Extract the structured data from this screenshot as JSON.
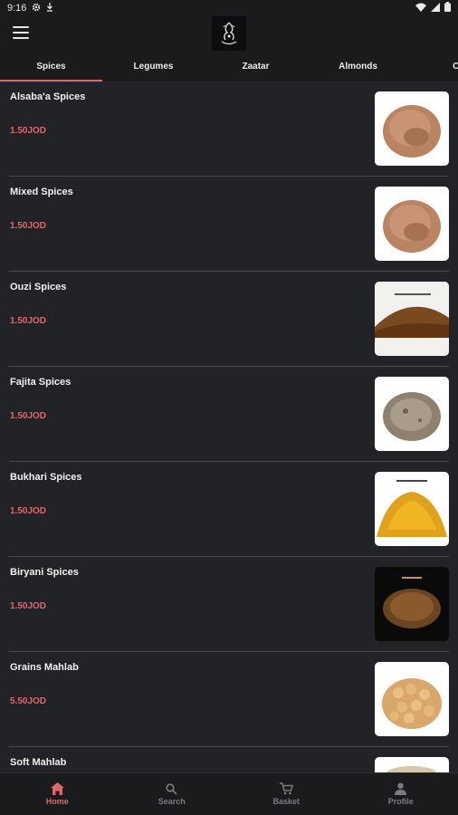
{
  "status": {
    "time": "9:16"
  },
  "tabs": [
    {
      "label": "Spices"
    },
    {
      "label": "Legumes"
    },
    {
      "label": "Zaatar"
    },
    {
      "label": "Almonds"
    },
    {
      "label": "Cof"
    }
  ],
  "items": [
    {
      "name": "Alsaba'a Spices",
      "price": "1.50JOD"
    },
    {
      "name": "Mixed Spices",
      "price": "1.50JOD"
    },
    {
      "name": "Ouzi Spices",
      "price": "1.50JOD"
    },
    {
      "name": "Fajita Spices",
      "price": "1.50JOD"
    },
    {
      "name": "Bukhari Spices",
      "price": "1.50JOD"
    },
    {
      "name": "Biryani Spices",
      "price": "1.50JOD"
    },
    {
      "name": "Grains Mahlab",
      "price": "5.50JOD"
    },
    {
      "name": "Soft Mahlab",
      "price": ""
    }
  ],
  "nav": [
    {
      "label": "Home"
    },
    {
      "label": "Search"
    },
    {
      "label": "Basket"
    },
    {
      "label": "Profile"
    }
  ],
  "colors": {
    "accent": "#e06767",
    "background": "#222327"
  }
}
